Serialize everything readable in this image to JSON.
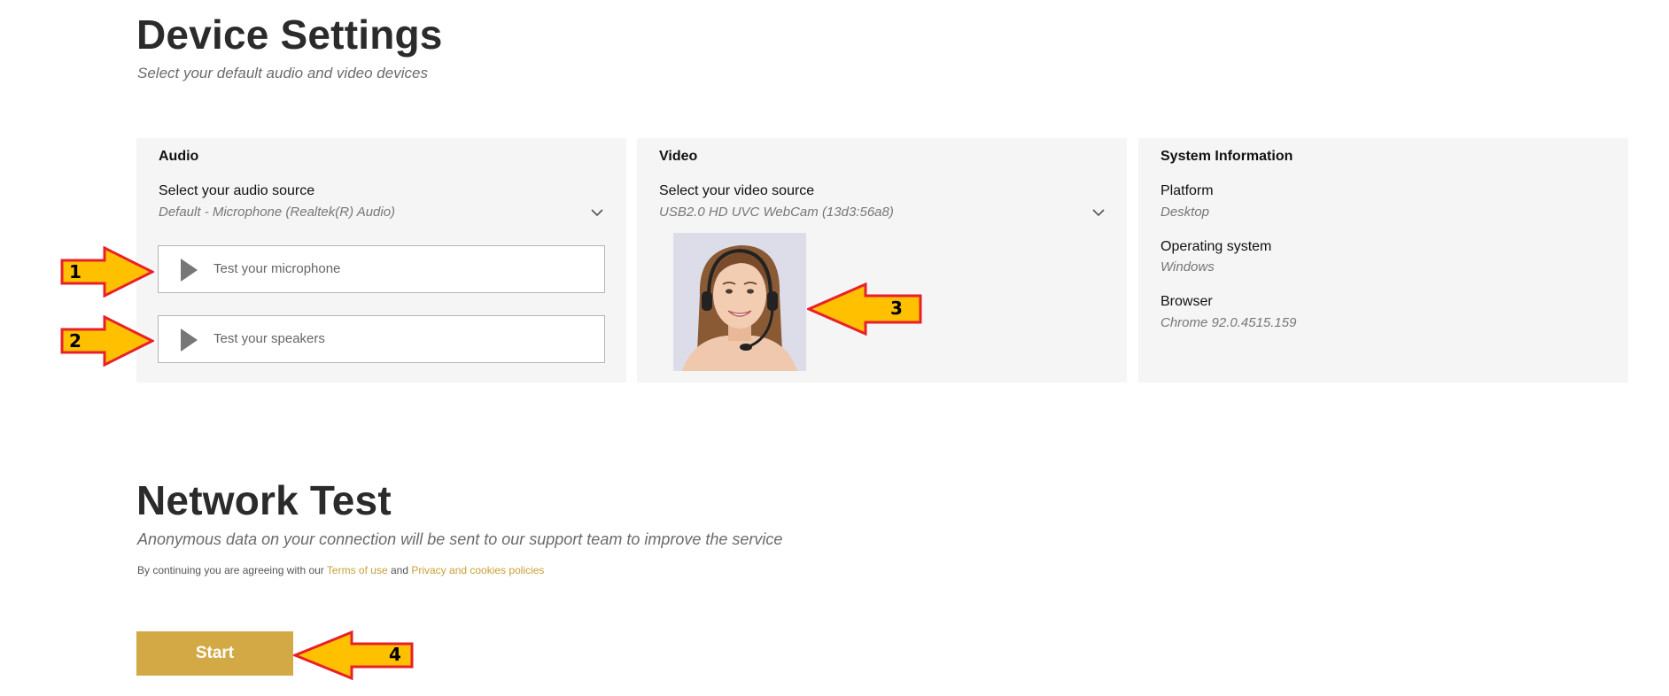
{
  "device_settings": {
    "title": "Device Settings",
    "subtitle": "Select your default audio and video devices"
  },
  "audio": {
    "heading": "Audio",
    "source_label": "Select your audio source",
    "source_value": "Default - Microphone (Realtek(R) Audio)",
    "test_microphone": "Test your microphone",
    "test_speakers": "Test your speakers"
  },
  "video": {
    "heading": "Video",
    "source_label": "Select your video source",
    "source_value": "USB2.0 HD UVC WebCam (13d3:56a8)"
  },
  "system_info": {
    "heading": "System Information",
    "items": [
      {
        "label": "Platform",
        "value": "Desktop"
      },
      {
        "label": "Operating system",
        "value": "Windows"
      },
      {
        "label": "Browser",
        "value": "Chrome 92.0.4515.159"
      }
    ]
  },
  "network_test": {
    "title": "Network Test",
    "subtitle": "Anonymous data on your connection will be sent to our support team to improve the service",
    "consent_prefix": "By continuing you are agreeing with our",
    "terms_link": "Terms of use",
    "consent_and": "and",
    "privacy_link": "Privacy and cookies policies",
    "start_button": "Start"
  },
  "annotations": {
    "marker_1": "1",
    "marker_2": "2",
    "marker_3": "3",
    "marker_4": "4",
    "arrow_fill": "#ffc000",
    "arrow_stroke": "#e8202a"
  },
  "colors": {
    "accent": "#d2a945",
    "link": "#c9a038",
    "panel_bg": "#f5f5f5"
  },
  "icons": {
    "play": "play-icon",
    "dropdown": "chevron-down-icon",
    "webcam": "webcam-preview-image"
  }
}
